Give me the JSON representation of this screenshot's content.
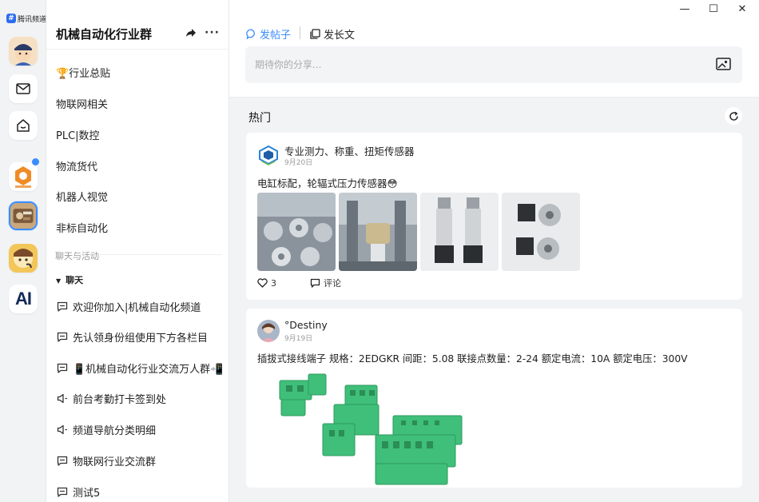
{
  "app": {
    "brand": "腾讯频道"
  },
  "rail": {
    "items": [
      {
        "name": "user-avatar"
      },
      {
        "name": "mail-icon"
      },
      {
        "name": "home-icon"
      },
      {
        "name": "guild-orange"
      },
      {
        "name": "guild-machine"
      },
      {
        "name": "guild-game"
      },
      {
        "name": "guild-ai",
        "label": "AI"
      }
    ]
  },
  "sidebar": {
    "title": "机械自动化行业群",
    "items": [
      "🏆行业总贴",
      "物联网相关",
      "PLC|数控",
      "物流货代",
      "机器人视觉",
      "非标自动化"
    ],
    "section_label": "聊天与活动",
    "group_label": "聊天",
    "chats": [
      {
        "label": "欢迎你加入|机械自动化频道",
        "icon": "chat-icon"
      },
      {
        "label": "先认领身份组使用下方各栏目",
        "icon": "chat-icon"
      },
      {
        "label": "📱机械自动化行业交流万人群📲",
        "icon": "chat-icon"
      },
      {
        "label": "前台考勤打卡签到处",
        "icon": "speaker-icon"
      },
      {
        "label": "频道导航分类明细",
        "icon": "speaker-icon"
      },
      {
        "label": "物联网行业交流群",
        "icon": "chat-icon"
      },
      {
        "label": "测试5",
        "icon": "chat-icon"
      }
    ]
  },
  "composer": {
    "tab_post": "发帖子",
    "tab_article": "发长文",
    "placeholder": "期待你的分享..."
  },
  "feed": {
    "hot_label": "热门",
    "posts": [
      {
        "author": "专业测力、称重、扭矩传感器",
        "date": "9月20日",
        "text": "电缸标配，轮辐式压力传感器😳",
        "likes": "3",
        "comment_label": "评论"
      },
      {
        "author": "°Destiny",
        "date": "9月19日",
        "text": "插拔式接线端子 规格：2EDGKR 间距：5.08 联接点数量：2-24 额定电流：10A 额定电压：300V"
      }
    ]
  },
  "colors": {
    "accent": "#3b8cff",
    "terminal_green": "#3fbf7a"
  }
}
